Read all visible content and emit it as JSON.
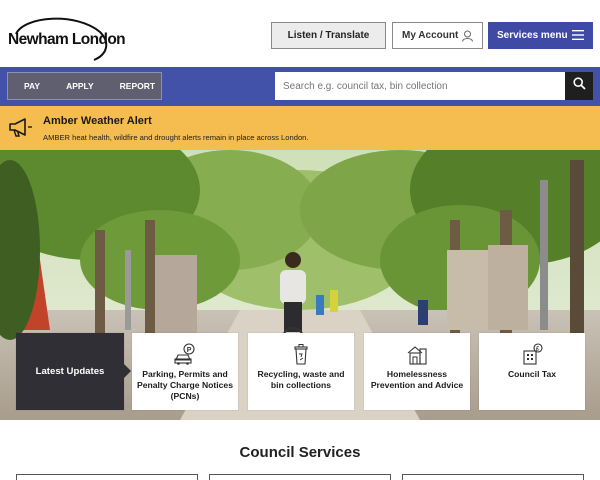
{
  "header": {
    "logo_text": "Newham London",
    "listen_translate": "Listen / Translate",
    "my_account": "My Account",
    "services_menu": "Services menu"
  },
  "nav": {
    "quick_links": [
      "PAY",
      "APPLY",
      "REPORT"
    ],
    "search_placeholder": "Search e.g. council tax, bin collection"
  },
  "alert": {
    "title": "Amber Weather Alert",
    "text": "AMBER heat health, wildfire and drought alerts remain in place across London."
  },
  "tiles": [
    {
      "label": "Latest Updates",
      "icon": ""
    },
    {
      "label": "Parking, Permits and Penalty Charge Notices (PCNs)",
      "icon": "car-parking-icon"
    },
    {
      "label": "Recycling, waste and bin collections",
      "icon": "recycling-bin-icon"
    },
    {
      "label": "Homelessness Prevention and Advice",
      "icon": "housing-icon"
    },
    {
      "label": "Council Tax",
      "icon": "council-tax-icon"
    }
  ],
  "services": {
    "heading": "Council Services"
  },
  "colors": {
    "brand_blue": "#4152a8",
    "alert_amber": "#f5bc4f",
    "dark_tile": "#2f2f35"
  }
}
